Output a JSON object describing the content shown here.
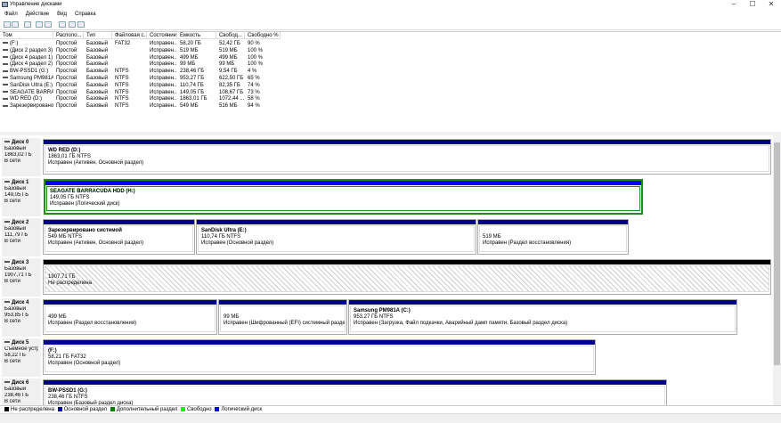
{
  "window": {
    "title": "Управление дисками",
    "min": "–",
    "max": "☐",
    "close": "✕"
  },
  "menu": [
    "Файл",
    "Действие",
    "Вид",
    "Справка"
  ],
  "toolbar": [
    "back-icon",
    "forward-icon",
    "list-icon",
    "help-icon",
    "properties-icon",
    "connect-icon",
    "check-icon",
    "window-icon"
  ],
  "columns": [
    "Том",
    "Располо...",
    "Тип",
    "Файловая с...",
    "Состояние",
    "Емкость",
    "Свобод...",
    "Свободно %"
  ],
  "volumes": [
    [
      "(F:)",
      "Простой",
      "Базовый",
      "FAT32",
      "Исправен...",
      "58,20 ГБ",
      "52,42 ГБ",
      "90 %"
    ],
    [
      "(Диск 2 раздел 3)",
      "Простой",
      "Базовый",
      "",
      "Исправен...",
      "519 МБ",
      "519 МБ",
      "100 %"
    ],
    [
      "(Диск 4 раздел 1)",
      "Простой",
      "Базовый",
      "",
      "Исправен...",
      "499 МБ",
      "499 МБ",
      "100 %"
    ],
    [
      "(Диск 4 раздел 2)",
      "Простой",
      "Базовый",
      "",
      "Исправен...",
      "99 МБ",
      "99 МБ",
      "100 %"
    ],
    [
      "BW-PSSD1 (G:)",
      "Простой",
      "Базовый",
      "NTFS",
      "Исправен...",
      "238,46 ГБ",
      "9,54 ГБ",
      "4 %"
    ],
    [
      "Samsung PM981A...",
      "Простой",
      "Базовый",
      "NTFS",
      "Исправен...",
      "953,27 ГБ",
      "622,50 ГБ",
      "65 %"
    ],
    [
      "SanDisk Ultra (E:)",
      "Простой",
      "Базовый",
      "NTFS",
      "Исправен...",
      "110,74 ГБ",
      "82,35 ГБ",
      "74 %"
    ],
    [
      "SEAGATE BARRAC...",
      "Простой",
      "Базовый",
      "NTFS",
      "Исправен...",
      "149,05 ГБ",
      "108,67 ГБ",
      "73 %"
    ],
    [
      "WD RED (D:)",
      "Простой",
      "Базовый",
      "NTFS",
      "Исправен...",
      "1863,01 ГБ",
      "1072,44 ...",
      "58 %"
    ],
    [
      "Зарезервировано...",
      "Простой",
      "Базовый",
      "NTFS",
      "Исправен...",
      "549 МБ",
      "516 МБ",
      "94 %"
    ]
  ],
  "disks": [
    {
      "name": "Диск 0",
      "type": "Базовый",
      "size": "1863,02 ГБ",
      "state": "В сети",
      "parts": [
        {
          "title": "WD RED  (D:)",
          "size": "1863,01 ГБ NTFS",
          "status": "Исправен (Активен, Основной раздел)"
        }
      ]
    },
    {
      "name": "Диск 1",
      "type": "Базовый",
      "size": "149,05 ГБ",
      "state": "В сети",
      "parts": [
        {
          "title": "SEAGATE BARRACUDA HDD  (H:)",
          "size": "149,05 ГБ NTFS",
          "status": "Исправен (Логический диск)"
        }
      ]
    },
    {
      "name": "Диск 2",
      "type": "Базовый",
      "size": "111,79 ГБ",
      "state": "В сети",
      "parts": [
        {
          "title": "Зарезервировано системой",
          "size": "549 МБ NTFS",
          "status": "Исправен (Активен, Основной раздел)"
        },
        {
          "title": "SanDisk Ultra  (E:)",
          "size": "110,74 ГБ NTFS",
          "status": "Исправен (Основной раздел)"
        },
        {
          "title": "",
          "size": "519 МБ",
          "status": "Исправен (Раздел восстановления)"
        }
      ]
    },
    {
      "name": "Диск 3",
      "type": "Базовый",
      "size": "1907,71 ГБ",
      "state": "В сети",
      "parts": [
        {
          "title": "",
          "size": "1907,71 ГБ",
          "status": "Не распределена"
        }
      ]
    },
    {
      "name": "Диск 4",
      "type": "Базовый",
      "size": "953,85 ГБ",
      "state": "В сети",
      "parts": [
        {
          "title": "",
          "size": "499 МБ",
          "status": "Исправен (Раздел восстановления)"
        },
        {
          "title": "",
          "size": "99 МБ",
          "status": "Исправен (Шифрованный (EFI) системный раздел)"
        },
        {
          "title": "Samsung PM981A  (C:)",
          "size": "953,27 ГБ NTFS",
          "status": "Исправен (Загрузка, Файл подкачки, Аварийный дамп памяти, Базовый раздел диска)"
        }
      ]
    },
    {
      "name": "Диск 5",
      "type": "Съемное устройство",
      "size": "58,22 ГБ",
      "state": "В сети",
      "parts": [
        {
          "title": "(F:)",
          "size": "58,21 ГБ FAT32",
          "status": "Исправен (Основной раздел)"
        }
      ]
    },
    {
      "name": "Диск 6",
      "type": "Базовый",
      "size": "238,46 ГБ",
      "state": "В сети",
      "parts": [
        {
          "title": "BW-PSSD1  (G:)",
          "size": "238,46 ГБ NTFS",
          "status": "Исправен (Базовый раздел диска)"
        }
      ]
    }
  ],
  "legend": [
    {
      "label": "Не распределена",
      "color": "#000000"
    },
    {
      "label": "Основной раздел",
      "color": "#00008b"
    },
    {
      "label": "Дополнительный раздел",
      "color": "#008000"
    },
    {
      "label": "Свободно",
      "color": "#00ff00"
    },
    {
      "label": "Логический диск",
      "color": "#0000ff"
    }
  ]
}
